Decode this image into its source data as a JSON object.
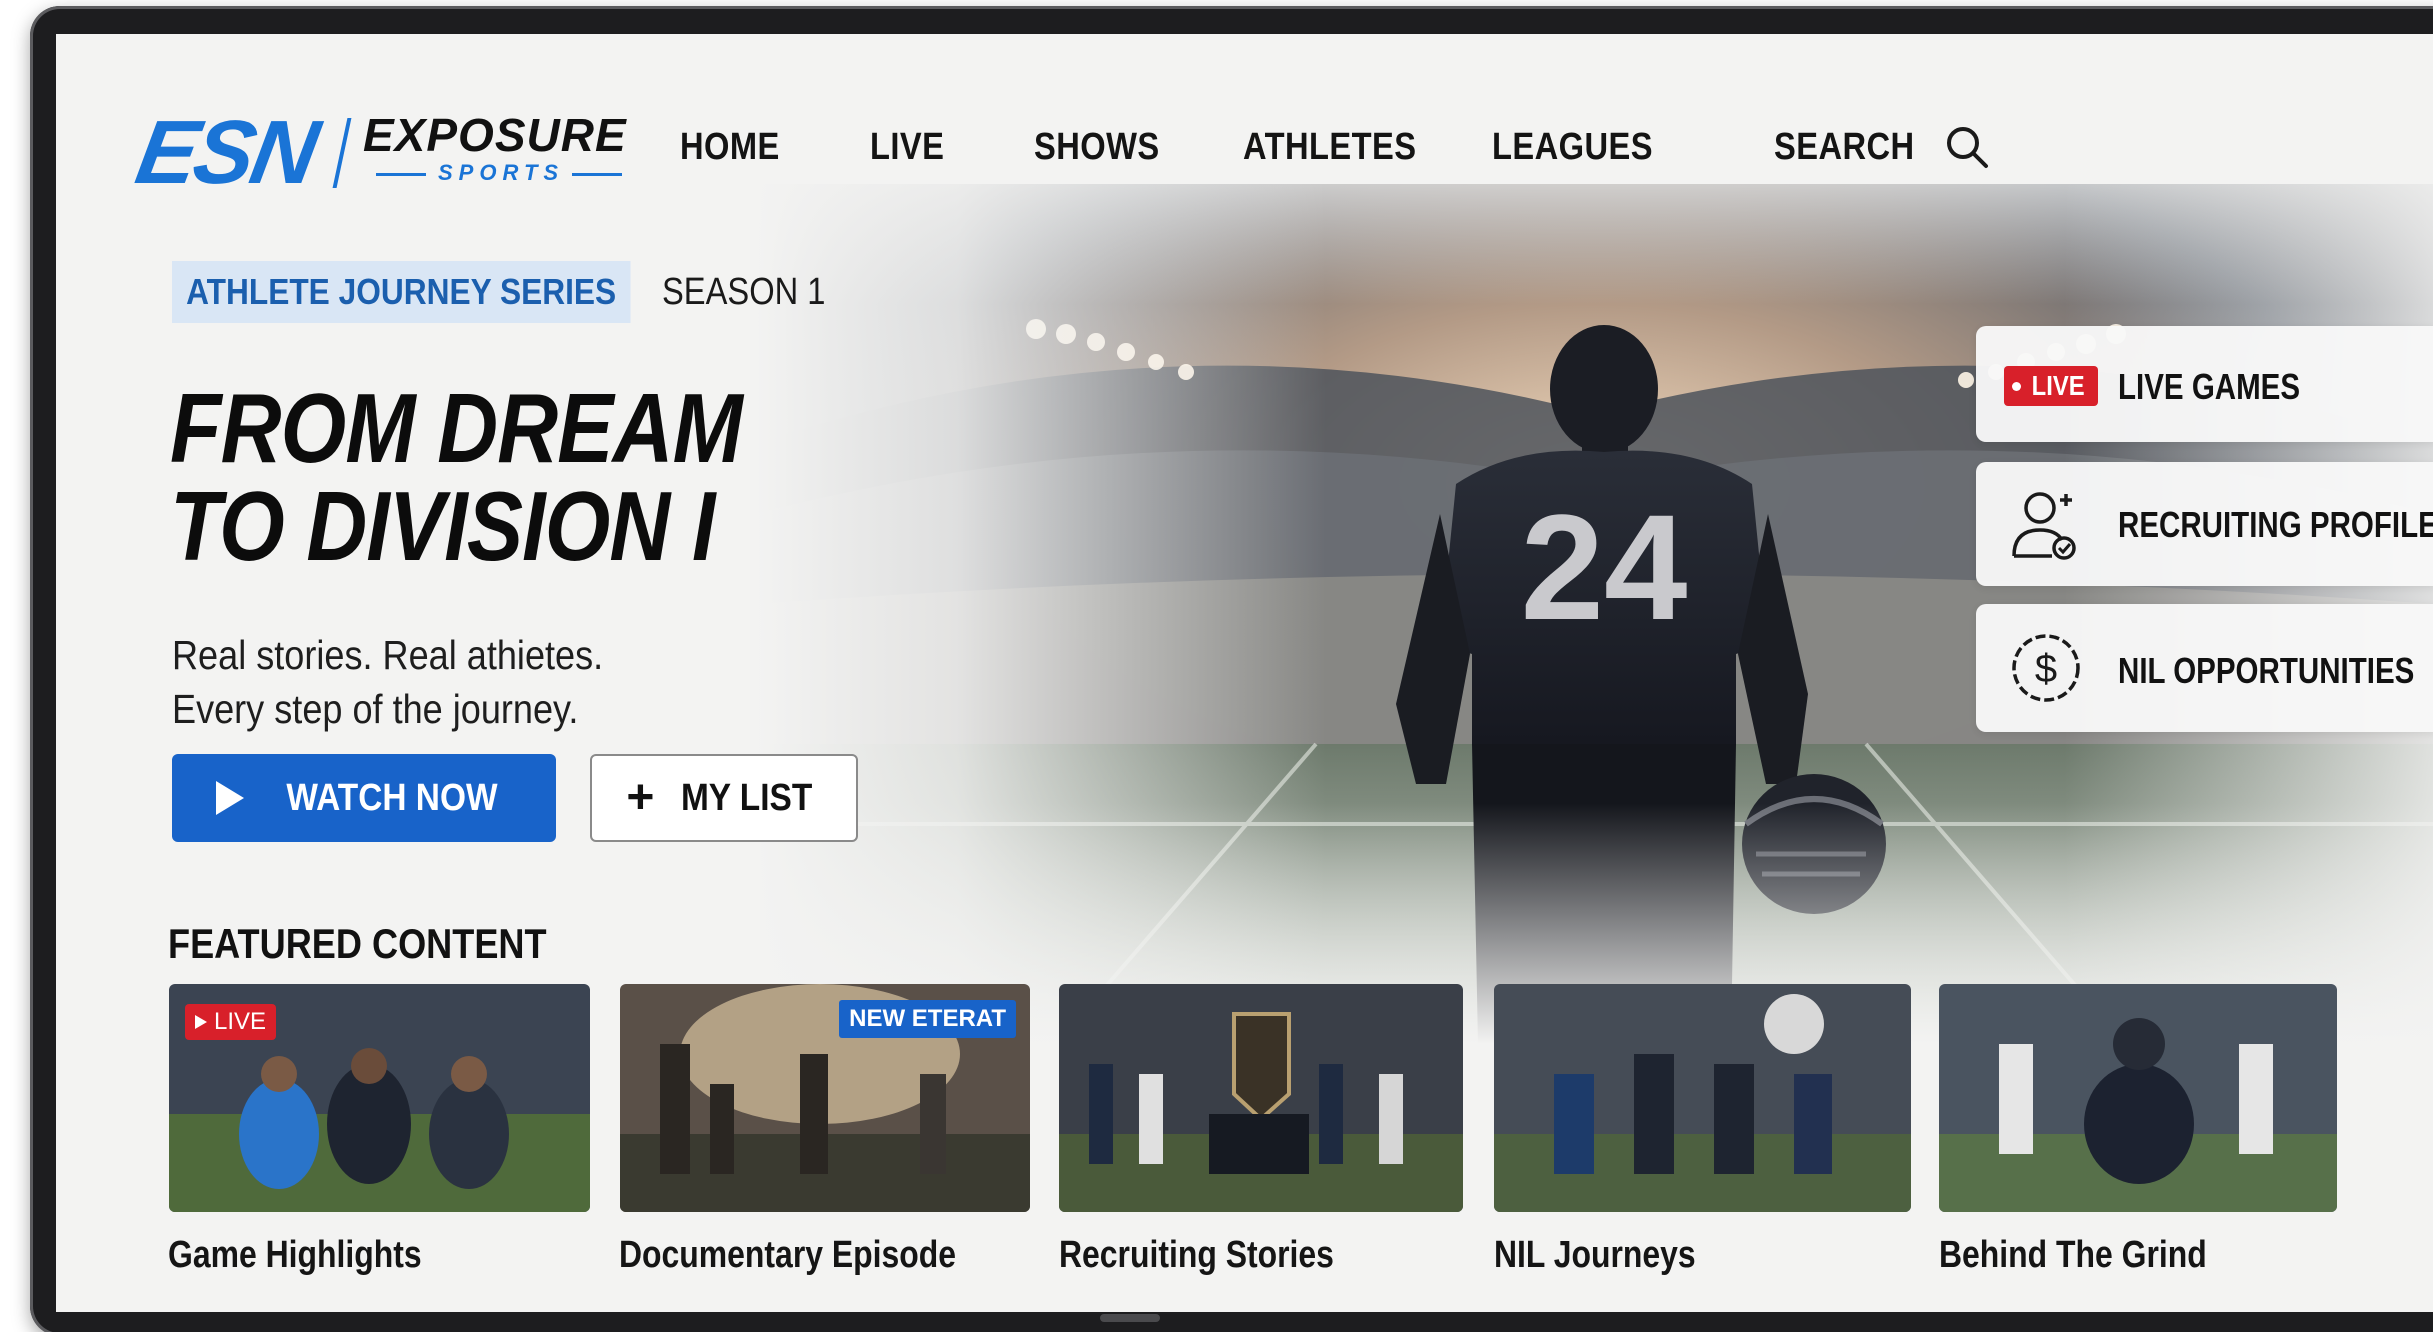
{
  "brand": {
    "mark": "ESN",
    "name": "EXPOSURE",
    "sub": "SPORTS",
    "accent_color": "#1a74d6"
  },
  "nav": {
    "items": [
      "HOME",
      "LIVE",
      "SHOWS",
      "ATHLETES",
      "LEAGUES",
      "SEARCH"
    ],
    "search_icon": "search-icon"
  },
  "hero": {
    "series": "ATHLETE JOURNEY SERIES",
    "season": "SEASON 1",
    "headline_line1": "FROM DREAM",
    "headline_line2": "TO DIVISION I",
    "tagline_line1": "Real stories. Real athietes.",
    "tagline_line2": "Every step of the journey.",
    "watch_label": "WATCH NOW",
    "list_label": "MY LIST",
    "jersey_number": "24",
    "primary_color": "#1863c9"
  },
  "side_cards": {
    "live_badge": "LIVE",
    "live_label": "LIVE GAMES",
    "recruit_label": "RECRUITING PROFILE",
    "nil_label": "NIL OPPORTUNITIES",
    "live_color": "#d8202a"
  },
  "featured": {
    "title": "FEATURED CONTENT",
    "items": [
      {
        "label": "Game Highlights",
        "badge": "LIVE"
      },
      {
        "label": "Documentary Episode",
        "badge": "NEW ETERAT"
      },
      {
        "label": "Recruiting Stories"
      },
      {
        "label": "NIL Journeys"
      },
      {
        "label": "Behind The Grind"
      }
    ]
  }
}
